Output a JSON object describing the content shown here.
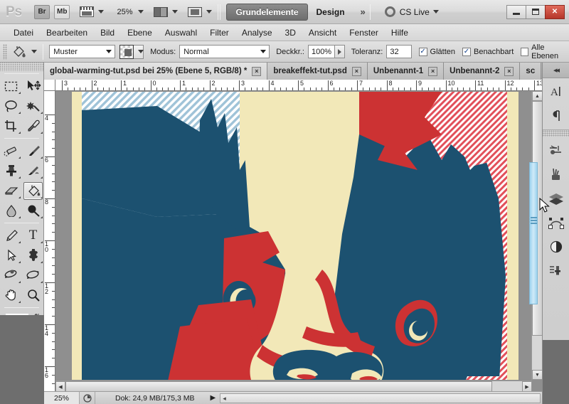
{
  "app": {
    "name": "Ps",
    "logo_label": "Ps"
  },
  "titlebar": {
    "bridge_button": "Br",
    "minibridge_button": "Mb",
    "zoom_level": "25%",
    "view_extras_icon": "view-extras-icon",
    "arrange_icon": "arrange-documents-icon",
    "screenmode_icon": "screen-mode-icon",
    "workspace_active": "Grundelemente",
    "workspace_second": "Design",
    "workspace_more": "»",
    "cs_live": "CS Live",
    "cs_live_caret": "▾",
    "minimize": "–",
    "maximize": "❐",
    "close": "×"
  },
  "menubar": {
    "items": [
      "Datei",
      "Bearbeiten",
      "Bild",
      "Ebene",
      "Auswahl",
      "Filter",
      "Analyse",
      "3D",
      "Ansicht",
      "Fenster",
      "Hilfe"
    ]
  },
  "optionsbar": {
    "tool_icon": "paint-bucket-icon",
    "fill_source": "Muster",
    "pattern_swatch": "pattern-swatch",
    "mode_label": "Modus:",
    "mode_value": "Normal",
    "opacity_label": "Deckkr.:",
    "opacity_value": "100%",
    "tolerance_label": "Toleranz:",
    "tolerance_value": "32",
    "checkboxes": [
      {
        "label": "Glätten",
        "checked": true
      },
      {
        "label": "Benachbart",
        "checked": true
      },
      {
        "label": "Alle Ebenen",
        "checked": false
      }
    ]
  },
  "tabs": {
    "items": [
      {
        "title": "global-warming-tut.psd bei 25% (Ebene 5, RGB/8) *",
        "active": true,
        "close": "×"
      },
      {
        "title": "breakeffekt-tut.psd",
        "active": false,
        "close": "×"
      },
      {
        "title": "Unbenannt-1",
        "active": false,
        "close": "×"
      },
      {
        "title": "Unbenannt-2",
        "active": false,
        "close": "×"
      },
      {
        "title": "sc",
        "active": false,
        "close": ""
      }
    ],
    "overflow": "»"
  },
  "toolbar": {
    "tools": [
      {
        "name": "rectangular-marquee-tool",
        "glyph": "⬚",
        "has_submenu": true
      },
      {
        "name": "move-tool",
        "glyph": "✣",
        "has_submenu": false
      },
      {
        "name": "lasso-tool",
        "glyph": "❦",
        "has_submenu": true
      },
      {
        "name": "magic-wand-tool",
        "glyph": "✳",
        "has_submenu": true
      },
      {
        "name": "crop-tool",
        "glyph": "⌷",
        "has_submenu": true
      },
      {
        "name": "eyedropper-tool",
        "glyph": "✐",
        "has_submenu": true
      },
      {
        "name": "spot-healing-brush-tool",
        "glyph": "✒",
        "has_submenu": true
      },
      {
        "name": "brush-tool",
        "glyph": "✎",
        "has_submenu": true
      },
      {
        "name": "clone-stamp-tool",
        "glyph": "⚑",
        "has_submenu": true
      },
      {
        "name": "history-brush-tool",
        "glyph": "⁀",
        "has_submenu": true
      },
      {
        "name": "eraser-tool",
        "glyph": "◧",
        "has_submenu": true
      },
      {
        "name": "paint-bucket-tool",
        "glyph": "◕",
        "has_submenu": true,
        "active": true
      },
      {
        "name": "blur-tool",
        "glyph": "●",
        "has_submenu": true
      },
      {
        "name": "dodge-tool",
        "glyph": "⚲",
        "has_submenu": true
      },
      {
        "name": "pen-tool",
        "glyph": "✒",
        "has_submenu": true
      },
      {
        "name": "horizontal-type-tool",
        "glyph": "T",
        "has_submenu": true
      },
      {
        "name": "path-selection-tool",
        "glyph": "➤",
        "has_submenu": true
      },
      {
        "name": "custom-shape-tool",
        "glyph": "⬟",
        "has_submenu": true
      },
      {
        "name": "3d-object-rotate-tool",
        "glyph": "◐",
        "has_submenu": true
      },
      {
        "name": "3d-camera-rotate-tool",
        "glyph": "◑",
        "has_submenu": true
      },
      {
        "name": "hand-tool",
        "glyph": "✋",
        "has_submenu": true
      },
      {
        "name": "zoom-tool",
        "glyph": "⌕",
        "has_submenu": false
      }
    ],
    "foreground_color": "#6e6e6e",
    "background_color": "#ffffff",
    "swap_icon": "swap-colors-icon",
    "default_colors_icon": "default-colors-icon",
    "quickmask_icon": "quick-mask-icon"
  },
  "rulers": {
    "unit": "cm",
    "horizontal_labels": [
      "3",
      "2",
      "1",
      "0",
      "1",
      "2",
      "3",
      "4",
      "5",
      "6",
      "7",
      "8",
      "9",
      "10",
      "11",
      "12",
      "13"
    ],
    "vertical_labels": [
      "4",
      "6",
      "8",
      "10",
      "12",
      "14",
      "16"
    ]
  },
  "statusbar": {
    "zoom": "25%",
    "preview_icon": "preview-clock-icon",
    "doc_info": "Dok: 24,9 MB/175,3 MB",
    "play_icon": "▶"
  },
  "dock": {
    "collapse_icon": "◂◂",
    "groups": [
      {
        "items": [
          {
            "name": "character-panel-icon",
            "glyph": "A"
          },
          {
            "name": "paragraph-panel-icon",
            "glyph": "¶"
          }
        ]
      },
      {
        "items": [
          {
            "name": "tool-presets-panel-icon",
            "glyph": "⚒"
          },
          {
            "name": "brush-presets-panel-icon",
            "glyph": "☙"
          },
          {
            "name": "layer-comps-panel-icon",
            "glyph": "◈"
          },
          {
            "name": "paths-panel-icon",
            "glyph": "⬡"
          },
          {
            "name": "adjustments-panel-icon",
            "glyph": "◐"
          },
          {
            "name": "clone-source-panel-icon",
            "glyph": "☰"
          }
        ]
      }
    ]
  },
  "canvas": {
    "document_name": "global-warming-tut.psd",
    "artwork_description": "Stylized poster-art cow head illustration",
    "palette": {
      "cream": "#f2e8b8",
      "navy": "#1c5170",
      "red": "#cc3233",
      "light_blue_hatch": "#dce9f0",
      "canvas_gray": "#8f8f8f"
    }
  }
}
